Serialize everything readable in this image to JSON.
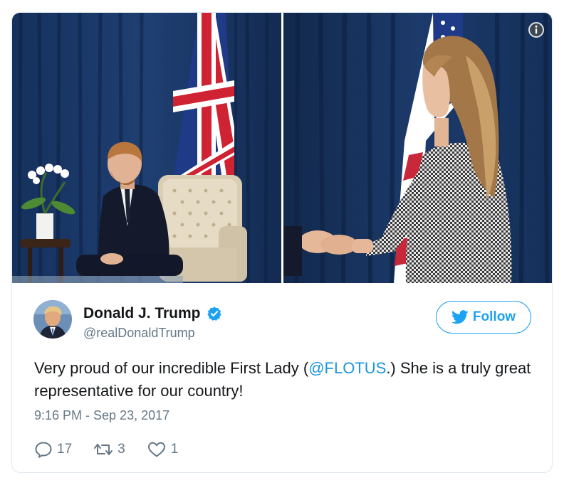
{
  "media": {
    "info_icon": "info-icon",
    "photos": [
      {
        "id": "left",
        "description": "man seated beside tufted armchair with flag backdrop"
      },
      {
        "id": "right",
        "description": "woman in houndstooth jacket shaking hands"
      }
    ]
  },
  "author": {
    "display_name": "Donald J. Trump",
    "handle": "@realDonaldTrump",
    "verified": true,
    "verified_icon": "verified-badge-icon"
  },
  "follow_button": {
    "label": "Follow",
    "icon": "twitter-bird-icon"
  },
  "tweet": {
    "text_before": "Very proud of our incredible First Lady (",
    "mention": "@FLOTUS",
    "text_after": ".) She is a truly great representative for our country!"
  },
  "timestamp": "9:16 PM - Sep 23, 2017",
  "actions": {
    "reply_count": "17",
    "retweet_count": "3",
    "like_count": "1"
  },
  "colors": {
    "accent": "#1da1f2",
    "mention": "#1b95e0",
    "secondary_text": "#657786",
    "primary_text": "#14171a",
    "border": "#e1e8ed"
  }
}
